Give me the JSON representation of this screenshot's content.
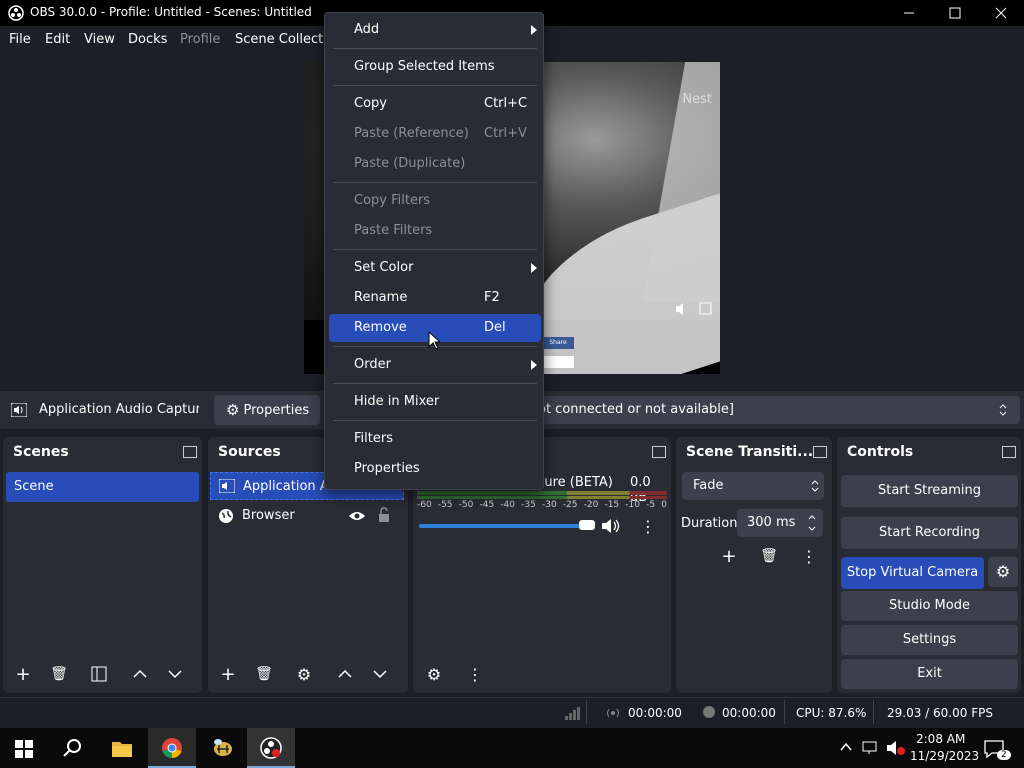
{
  "window": {
    "title": "OBS 30.0.0 - Profile: Untitled - Scenes: Untitled"
  },
  "menubar": [
    "File",
    "Edit",
    "View",
    "Docks",
    "Profile",
    "Scene Collectio"
  ],
  "preview": {
    "overlay_text": "Nest",
    "share_label": "Share"
  },
  "source_toolbar": {
    "source_name": "Application Audio Capture (",
    "properties_label": "Properties",
    "device_text": "ot connected or not available]"
  },
  "scenes": {
    "title": "Scenes",
    "items": [
      "Scene"
    ]
  },
  "sources": {
    "title": "Sources",
    "items": [
      "Application Audi",
      "Browser"
    ]
  },
  "mixer": {
    "source_label": "pture (BETA)",
    "db_label": "0.0 dB",
    "ticks": [
      "-60",
      "-55",
      "-50",
      "-45",
      "-40",
      "-35",
      "-30",
      "-25",
      "-20",
      "-15",
      "-10",
      "-5",
      "0"
    ]
  },
  "transitions": {
    "title": "Scene Transiti...",
    "type": "Fade",
    "duration_label": "Duration",
    "duration_value": "300 ms"
  },
  "controls": {
    "title": "Controls",
    "buttons": [
      "Start Streaming",
      "Start Recording",
      "Stop Virtual Camera",
      "Studio Mode",
      "Settings",
      "Exit"
    ]
  },
  "statusbar": {
    "stream_time": "00:00:00",
    "rec_time": "00:00:00",
    "cpu": "CPU: 87.6%",
    "fps": "29.03 / 60.00 FPS"
  },
  "taskbar": {
    "time": "2:08 AM",
    "date": "11/29/2023",
    "notification_count": "2"
  },
  "context_menu": {
    "items": [
      {
        "label": "Add",
        "shortcut": ""
      },
      {
        "label": "Group Selected Items",
        "shortcut": ""
      },
      {
        "label": "Copy",
        "shortcut": "Ctrl+C"
      },
      {
        "label": "Paste (Reference)",
        "shortcut": "Ctrl+V"
      },
      {
        "label": "Paste (Duplicate)",
        "shortcut": ""
      },
      {
        "label": "Copy Filters",
        "shortcut": ""
      },
      {
        "label": "Paste Filters",
        "shortcut": ""
      },
      {
        "label": "Set Color",
        "shortcut": ""
      },
      {
        "label": "Rename",
        "shortcut": "F2"
      },
      {
        "label": "Remove",
        "shortcut": "Del"
      },
      {
        "label": "Order",
        "shortcut": ""
      },
      {
        "label": "Hide in Mixer",
        "shortcut": ""
      },
      {
        "label": "Filters",
        "shortcut": ""
      },
      {
        "label": "Properties",
        "shortcut": ""
      }
    ]
  },
  "colors": {
    "accent": "#284cb8",
    "panel": "#2a2c35",
    "bg": "#1d1f26",
    "button": "#3c404d"
  }
}
